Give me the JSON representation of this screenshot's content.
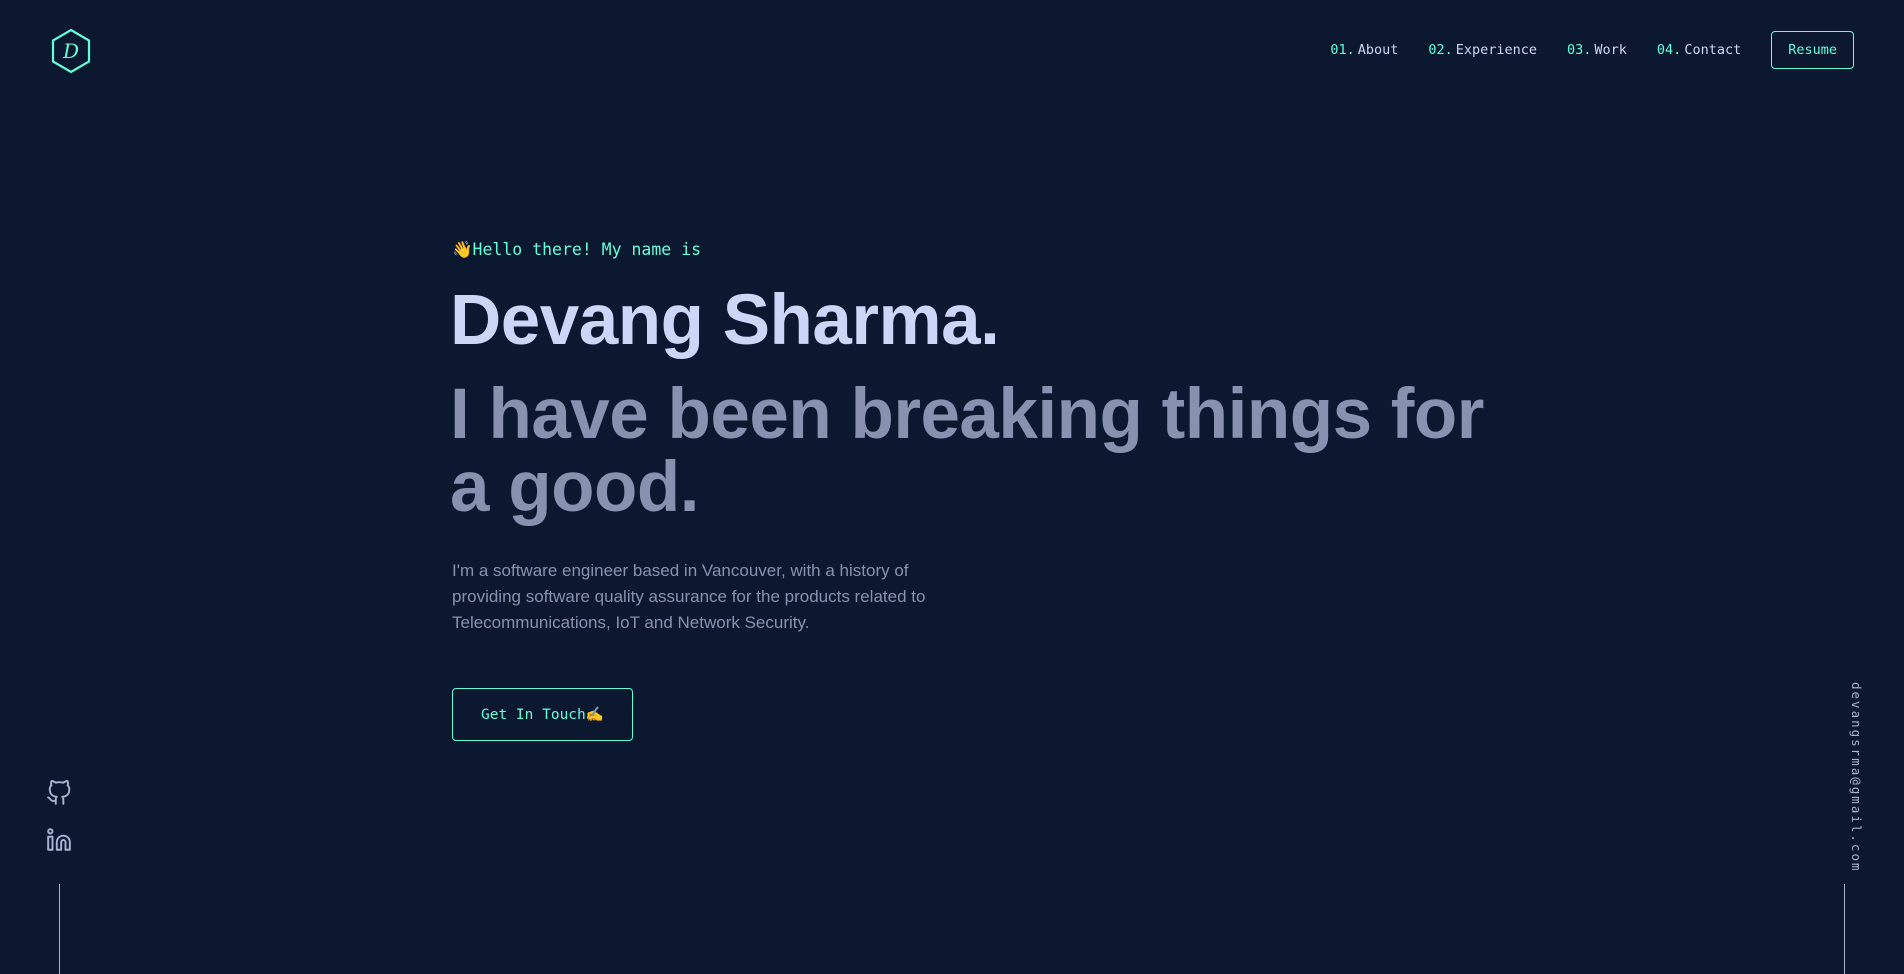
{
  "colors": {
    "background": "#0b1830",
    "accent": "#64ffda",
    "heading": "#ccd6f6",
    "muted": "#8892b0"
  },
  "logo": {
    "letter": "D",
    "icon": "hexagon-logo-icon"
  },
  "nav": {
    "items": [
      {
        "num": "01.",
        "label": "About"
      },
      {
        "num": "02.",
        "label": "Experience"
      },
      {
        "num": "03.",
        "label": "Work"
      },
      {
        "num": "04.",
        "label": "Contact"
      }
    ],
    "resume_label": "Resume"
  },
  "hero": {
    "greeting_emoji": "👋",
    "greeting": "Hello there! My name is",
    "name": "Devang Sharma.",
    "tagline_line1": "I have been breaking things for",
    "tagline_line2": "a good.",
    "bio": "I'm a software engineer based in Vancouver, with a history of providing software quality assurance for the products related to Telecommunications, IoT and Network Security.",
    "cta_label": "Get In Touch",
    "cta_emoji": "✍️"
  },
  "social": [
    {
      "icon": "github-icon"
    },
    {
      "icon": "linkedin-icon"
    }
  ],
  "email": "devangsrma@gmail.com"
}
